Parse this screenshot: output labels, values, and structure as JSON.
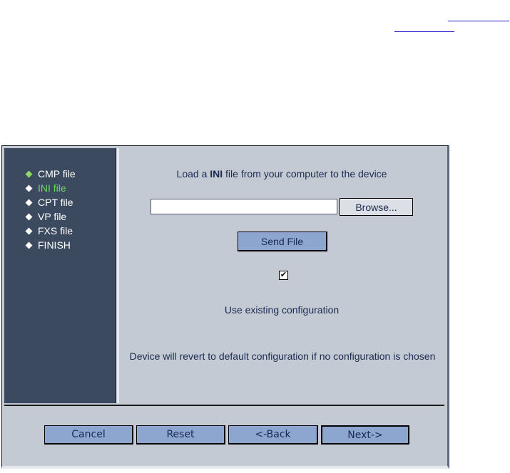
{
  "sidebar": {
    "items": [
      {
        "label": "CMP file"
      },
      {
        "label": "INI file"
      },
      {
        "label": "CPT file"
      },
      {
        "label": "VP file"
      },
      {
        "label": "FXS file"
      },
      {
        "label": "FINISH"
      }
    ],
    "active_label": "INI file"
  },
  "main": {
    "load_prefix": "Load a ",
    "load_bold": "INI",
    "load_suffix": " file from your computer to the device",
    "file_value": "",
    "browse_label": "Browse...",
    "send_label": "Send File",
    "use_existing_checked": true,
    "use_existing_label": "Use existing configuration",
    "revert_note": "Device will revert to default configuration if no configuration is chosen"
  },
  "footer": {
    "cancel_label": "Cancel",
    "reset_label": "Reset",
    "back_label": "<-Back",
    "next_label": "Next->"
  },
  "colors": {
    "sidebar_bg": "#3c4a60",
    "panel_bg": "#c4cad3",
    "button_bg": "#8ca6cf",
    "active_item": "#63dd5a"
  }
}
